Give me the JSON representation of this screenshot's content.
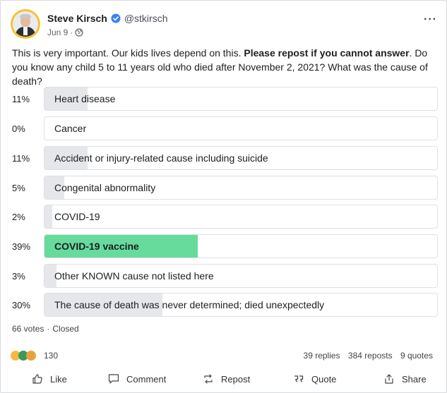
{
  "post": {
    "author_name": "Steve Kirsch",
    "handle": "@stkirsch",
    "date": "Jun 9",
    "sep": "·",
    "more": "···",
    "text_a": "This is very important. Our kids lives depend on this. ",
    "text_bold": "Please repost if you cannot answer",
    "text_b": ". Do you know any child 5 to 11 years old who died after November 2, 2021? What was the cause of death?"
  },
  "poll": {
    "options": [
      {
        "pct_label": "11%",
        "value": 11,
        "label": "Heart disease",
        "winner": false
      },
      {
        "pct_label": "0%",
        "value": 0,
        "label": "Cancer",
        "winner": false
      },
      {
        "pct_label": "11%",
        "value": 11,
        "label": "Accident or injury-related cause including suicide",
        "winner": false
      },
      {
        "pct_label": "5%",
        "value": 5,
        "label": "Congenital abnormality",
        "winner": false
      },
      {
        "pct_label": "2%",
        "value": 2,
        "label": "COVID-19",
        "winner": false
      },
      {
        "pct_label": "39%",
        "value": 39,
        "label": "COVID-19 vaccine",
        "winner": true
      },
      {
        "pct_label": "3%",
        "value": 3,
        "label": "Other KNOWN cause not listed here",
        "winner": false
      },
      {
        "pct_label": "30%",
        "value": 30,
        "label": "The cause of death was never determined; died unexpectedly",
        "winner": false
      }
    ],
    "votes": "66 votes",
    "dot": "·",
    "status": "Closed",
    "winner_color": "#66db9b",
    "bar_color": "#e5e7eb"
  },
  "stats": {
    "reaction_count": "130",
    "replies": "39 replies",
    "reposts": "384 reposts",
    "quotes": "9 quotes"
  },
  "actions": {
    "like": "Like",
    "comment": "Comment",
    "repost": "Repost",
    "quote": "Quote",
    "share": "Share"
  },
  "colors": {
    "verified": "#3b82f6",
    "accent": "#66db9b"
  },
  "icons": [
    "verified-icon",
    "globe-icon",
    "more-icon",
    "like-icon",
    "comment-icon",
    "repost-icon",
    "quote-icon",
    "share-icon"
  ]
}
